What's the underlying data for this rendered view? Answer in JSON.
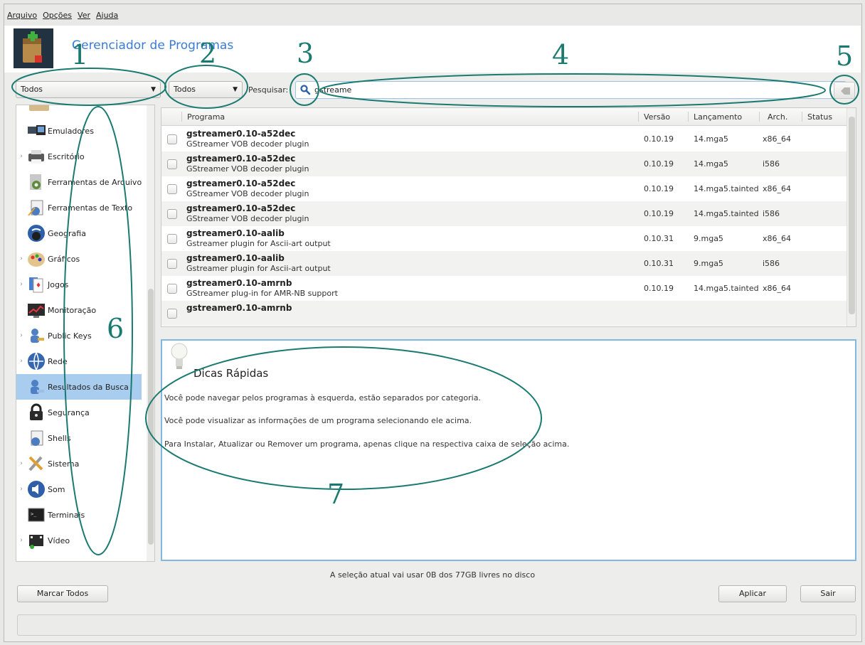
{
  "menubar": {
    "items": [
      "Arquivo",
      "Opções",
      "Ver",
      "Ajuda"
    ]
  },
  "header": {
    "title": "Gerenciador de Programas"
  },
  "toolbar": {
    "filter1": "Todos",
    "filter2": "Todos",
    "search_label": "Pesquisar:",
    "search_value": "gstreame"
  },
  "sidebar": {
    "items": [
      {
        "label": "Emuladores",
        "icon": "monitor-icon",
        "expandable": false
      },
      {
        "label": "Escritório",
        "icon": "printer-icon",
        "expandable": true
      },
      {
        "label": "Ferramentas de Arquivo",
        "icon": "file-tools-icon",
        "expandable": false
      },
      {
        "label": "Ferramentas de Texto",
        "icon": "text-tools-icon",
        "expandable": false
      },
      {
        "label": "Geografia",
        "icon": "globe-icon",
        "expandable": false
      },
      {
        "label": "Gráficos",
        "icon": "palette-icon",
        "expandable": true
      },
      {
        "label": "Jogos",
        "icon": "cards-icon",
        "expandable": true
      },
      {
        "label": "Monitoração",
        "icon": "monitor-chart-icon",
        "expandable": false
      },
      {
        "label": "Public Keys",
        "icon": "keys-icon",
        "expandable": true
      },
      {
        "label": "Rede",
        "icon": "network-globe-icon",
        "expandable": true
      },
      {
        "label": "Resultados da Busca",
        "icon": "search-results-icon",
        "expandable": false,
        "selected": true
      },
      {
        "label": "Segurança",
        "icon": "lock-icon",
        "expandable": false
      },
      {
        "label": "Shells",
        "icon": "shell-icon",
        "expandable": false
      },
      {
        "label": "Sistema",
        "icon": "tools-icon",
        "expandable": true
      },
      {
        "label": "Som",
        "icon": "speaker-icon",
        "expandable": true
      },
      {
        "label": "Terminais",
        "icon": "terminal-icon",
        "expandable": false
      },
      {
        "label": "Vídeo",
        "icon": "film-icon",
        "expandable": true
      }
    ]
  },
  "package_list": {
    "columns": [
      "Programa",
      "Versão",
      "Lançamento",
      "Arch.",
      "Status"
    ],
    "rows": [
      {
        "name": "gstreamer0.10-a52dec",
        "desc": "GStreamer VOB decoder plugin",
        "version": "0.10.19",
        "release": "14.mga5",
        "arch": "x86_64"
      },
      {
        "name": "gstreamer0.10-a52dec",
        "desc": "GStreamer VOB decoder plugin",
        "version": "0.10.19",
        "release": "14.mga5",
        "arch": "i586"
      },
      {
        "name": "gstreamer0.10-a52dec",
        "desc": "GStreamer VOB decoder plugin",
        "version": "0.10.19",
        "release": "14.mga5.tainted",
        "arch": "x86_64"
      },
      {
        "name": "gstreamer0.10-a52dec",
        "desc": "GStreamer VOB decoder plugin",
        "version": "0.10.19",
        "release": "14.mga5.tainted",
        "arch": "i586"
      },
      {
        "name": "gstreamer0.10-aalib",
        "desc": "Gstreamer plugin for Ascii-art output",
        "version": "0.10.31",
        "release": "9.mga5",
        "arch": "x86_64"
      },
      {
        "name": "gstreamer0.10-aalib",
        "desc": "Gstreamer plugin for Ascii-art output",
        "version": "0.10.31",
        "release": "9.mga5",
        "arch": "i586"
      },
      {
        "name": "gstreamer0.10-amrnb",
        "desc": "GStreamer plug-in for AMR-NB support",
        "version": "0.10.19",
        "release": "14.mga5.tainted",
        "arch": "x86_64"
      },
      {
        "name": "gstreamer0.10-amrnb",
        "desc": "",
        "version": "",
        "release": "",
        "arch": ""
      }
    ]
  },
  "info_panel": {
    "title": "Dicas Rápidas",
    "tips": [
      "Você pode navegar pelos programas à esquerda, estão separados por categoria.",
      "Você pode visualizar as informações de um programa selecionando ele acima.",
      "Para Instalar, Atualizar ou Remover um programa, apenas clique na respectiva caixa de seleção acima."
    ]
  },
  "status": "A seleção atual vai usar 0B dos 77GB livres no disco",
  "buttons": {
    "select_all": "Marcar Todos",
    "apply": "Aplicar",
    "quit": "Sair"
  },
  "annotations": [
    "1",
    "2",
    "3",
    "4",
    "5",
    "6",
    "7"
  ],
  "colors": {
    "accent": "#3a7bd5",
    "annotation": "#1a7a70",
    "selection": "#a9cdee",
    "info_border": "#82b7e3"
  }
}
